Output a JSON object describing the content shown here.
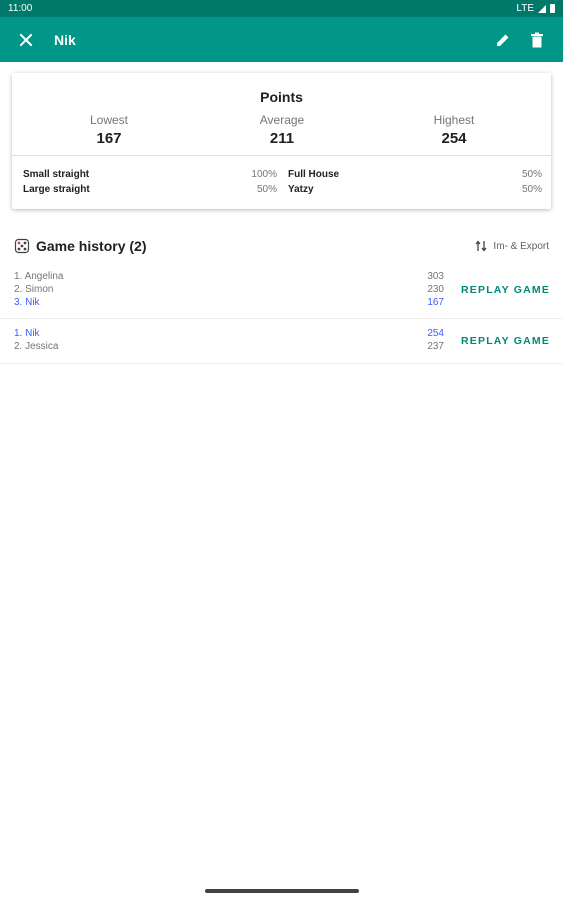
{
  "status_bar": {
    "time": "11:00",
    "network": "LTE"
  },
  "app_bar": {
    "title": "Nik"
  },
  "stats": {
    "title": "Points",
    "lowest_label": "Lowest",
    "lowest_value": "167",
    "average_label": "Average",
    "average_value": "211",
    "highest_label": "Highest",
    "highest_value": "254",
    "combinations": [
      {
        "name": "Small straight",
        "percent": "100%"
      },
      {
        "name": "Large straight",
        "percent": "50%"
      },
      {
        "name": "Full House",
        "percent": "50%"
      },
      {
        "name": "Yatzy",
        "percent": "50%"
      }
    ]
  },
  "history": {
    "title": "Game history (2)",
    "export_label": "Im- & Export",
    "games": [
      {
        "players": [
          {
            "name": "1. Angelina",
            "score": "303",
            "highlight": false
          },
          {
            "name": "2. Simon",
            "score": "230",
            "highlight": false
          },
          {
            "name": "3. Nik",
            "score": "167",
            "highlight": true
          }
        ],
        "replay_label": "REPLAY GAME"
      },
      {
        "players": [
          {
            "name": "1. Nik",
            "score": "254",
            "highlight": true
          },
          {
            "name": "2. Jessica",
            "score": "237",
            "highlight": false
          }
        ],
        "replay_label": "REPLAY GAME"
      }
    ]
  },
  "colors": {
    "primary": "#009688",
    "primary_dark": "#00796b",
    "highlight_player": "#3d5afe",
    "accent_button": "#00897b"
  },
  "icons": [
    "close-icon",
    "edit-icon",
    "delete-icon",
    "dice-icon",
    "swap-vertical-icon"
  ]
}
